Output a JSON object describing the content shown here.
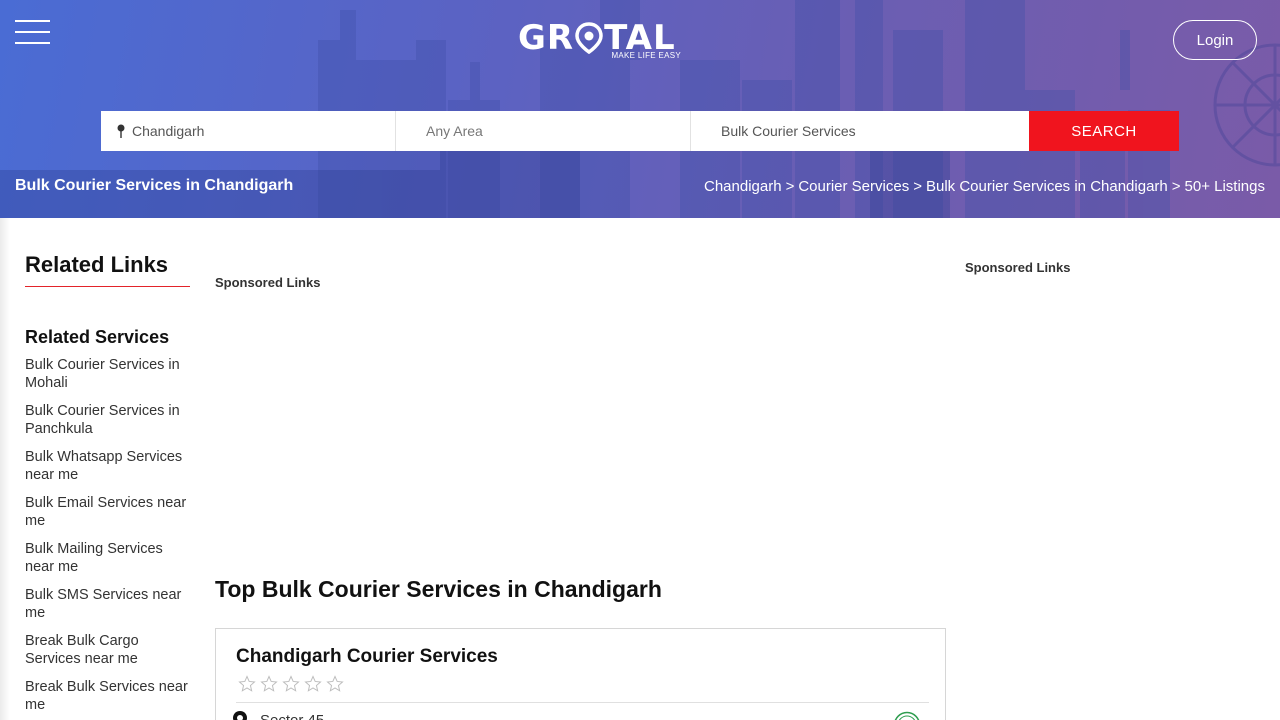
{
  "header": {
    "logo_text_left": "GR",
    "logo_text_right": "TAL",
    "logo_tagline": "MAKE LIFE EASY",
    "login_label": "Login"
  },
  "search": {
    "city_value": "Chandigarh",
    "area_placeholder": "Any Area",
    "query_value": "Bulk Courier Services",
    "button_label": "SEARCH"
  },
  "hero": {
    "title": "Bulk Courier Services in Chandigarh",
    "breadcrumb": [
      "Chandigarh",
      ">",
      "Courier Services",
      ">",
      "Bulk Courier Services in Chandigarh",
      ">",
      "50+ Listings"
    ]
  },
  "sidebar": {
    "related_links_heading": "Related Links",
    "related_services_heading": "Related Services",
    "items": [
      "Bulk Courier Services in Mohali",
      "Bulk Courier Services in Panchkula",
      "Bulk Whatsapp Services near me",
      "Bulk Email Services near me",
      "Bulk Mailing Services near me",
      "Bulk SMS Services near me",
      "Break Bulk Cargo Services near me",
      "Break Bulk Services near me"
    ]
  },
  "main": {
    "sponsored_label": "Sponsored Links",
    "right_sponsored_label": "Sponsored Links",
    "section_title": "Top Bulk Courier Services in Chandigarh",
    "listing": {
      "name": "Chandigarh Courier Services",
      "rating": 0,
      "rating_max": 5,
      "location": "Sector 45"
    }
  },
  "colors": {
    "search_button": "#f0141e",
    "accent_underline": "#e3232a",
    "hero_start": "#4a6cd4",
    "hero_end": "#7a5ba8"
  }
}
